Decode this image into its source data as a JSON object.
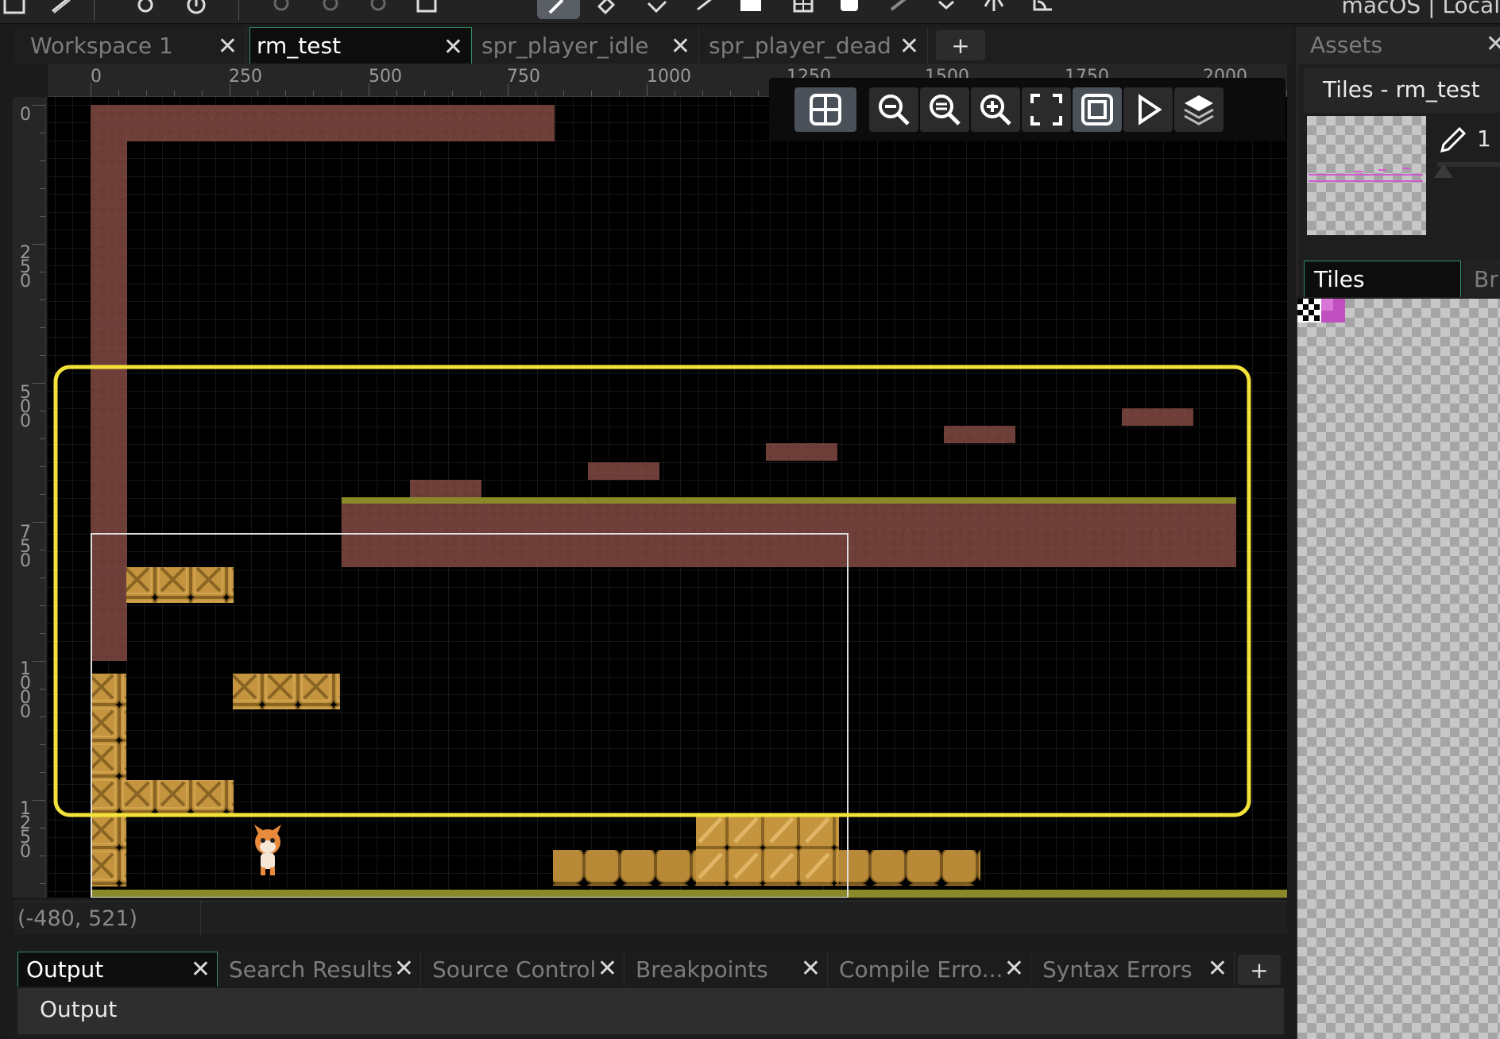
{
  "topbar": {
    "window_text": "macOS | Local"
  },
  "document_tabs": [
    {
      "label": "Workspace 1",
      "active": false
    },
    {
      "label": "rm_test",
      "active": true
    },
    {
      "label": "spr_player_idle",
      "active": false
    },
    {
      "label": "spr_player_dead",
      "active": false
    }
  ],
  "add_tab_label": "+",
  "ruler": {
    "horizontal_labels": [
      "0",
      "250",
      "500",
      "750",
      "1000",
      "1250",
      "1500",
      "1750",
      "2000"
    ],
    "vertical_labels": [
      "0",
      "250",
      "500",
      "750",
      "1000",
      "1250"
    ]
  },
  "room_toolbar": {
    "buttons": [
      "grid-icon",
      "zoom-out-icon",
      "zoom-reset-icon",
      "zoom-in-icon",
      "fullscreen-icon",
      "frame-view-icon",
      "play-icon",
      "layers-icon"
    ]
  },
  "statusbar": {
    "coords": "(-480, 521)"
  },
  "dock": {
    "tabs": [
      {
        "label": "Output",
        "active": true
      },
      {
        "label": "Search Results",
        "active": false
      },
      {
        "label": "Source Control",
        "active": false
      },
      {
        "label": "Breakpoints",
        "active": false
      },
      {
        "label": "Compile Erro...",
        "active": false
      },
      {
        "label": "Syntax Errors",
        "active": false
      }
    ],
    "add_label": "+",
    "body_label": "Output"
  },
  "right_panel": {
    "header": "Assets",
    "title": "Tiles - rm_test",
    "brush_size": "1",
    "tabs": [
      "Tiles",
      "Bru"
    ]
  },
  "colors": {
    "highlight": "#f2e23a",
    "wall": "#6e3f38",
    "crate": "#c4943e",
    "grass": "#8a8a2a",
    "active_tab_border": "#2f8f62"
  }
}
